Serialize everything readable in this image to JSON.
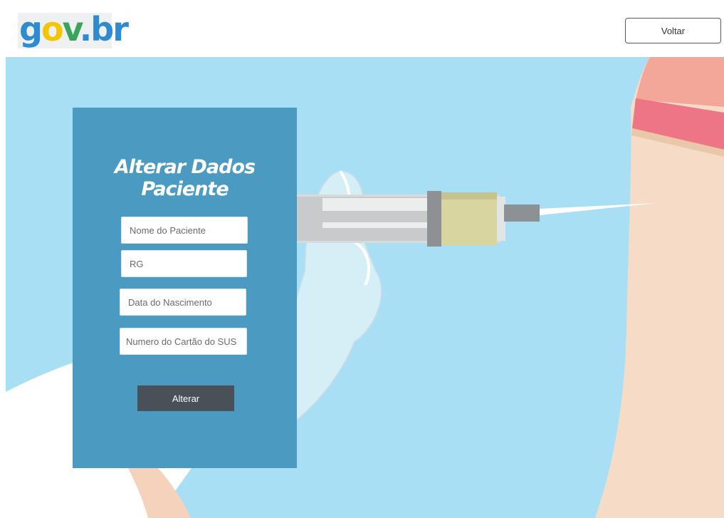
{
  "header": {
    "logo_text": "gov.br",
    "back_label": "Voltar"
  },
  "form": {
    "title": "Alterar Dados Paciente",
    "fields": [
      {
        "placeholder": "Nome do Paciente",
        "value": ""
      },
      {
        "placeholder": "RG",
        "value": ""
      },
      {
        "placeholder": "Data do Nascimento",
        "value": ""
      },
      {
        "placeholder": "Numero do Cartão do SUS",
        "value": ""
      }
    ],
    "submit_label": "Alterar"
  },
  "colors": {
    "background_sky": "#a9dff4",
    "panel": "#4a9ac2",
    "button": "#495058"
  }
}
